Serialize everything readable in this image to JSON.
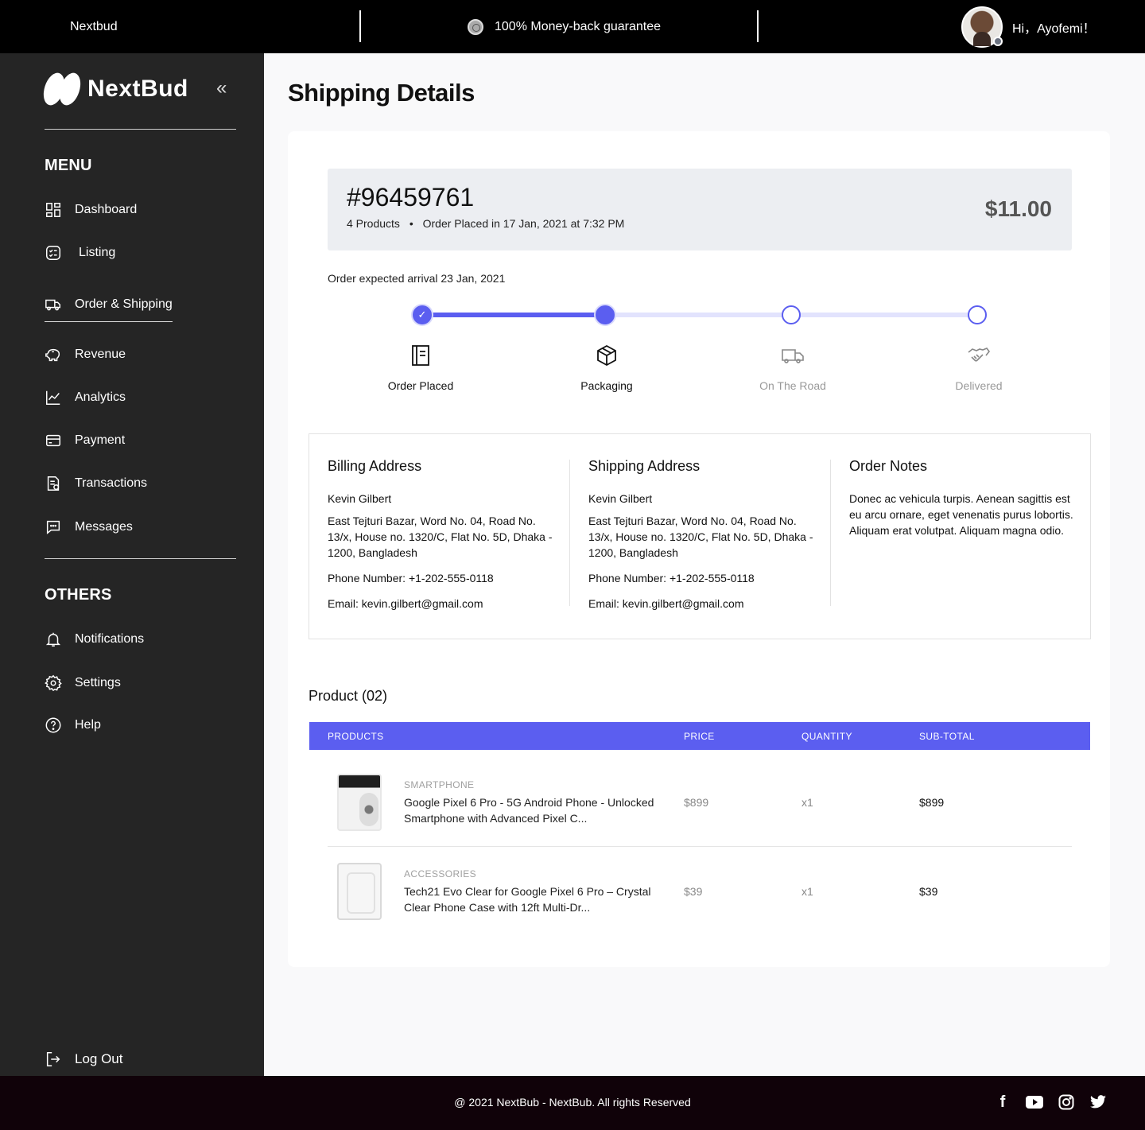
{
  "topbar": {
    "brand": "Nextbud",
    "promo": "100% Money-back guarantee",
    "greeting": "Hi，Ayofemi！"
  },
  "sidebar": {
    "logo": "NextBud",
    "collapse_icon": "double-chevron-left",
    "menu_title": "MENU",
    "menu_items": [
      {
        "label": "Dashboard",
        "icon": "dashboard-icon"
      },
      {
        "label": "Listing",
        "icon": "listing-icon"
      },
      {
        "label": "Order & Shipping",
        "icon": "truck-icon",
        "active": true
      },
      {
        "label": "Revenue",
        "icon": "piggy-bank-icon"
      },
      {
        "label": "Analytics",
        "icon": "chart-icon"
      },
      {
        "label": "Payment",
        "icon": "card-icon"
      },
      {
        "label": "Transactions",
        "icon": "receipt-icon"
      },
      {
        "label": "Messages",
        "icon": "chat-icon"
      }
    ],
    "others_title": "OTHERS",
    "other_items": [
      {
        "label": "Notifications",
        "icon": "bell-icon"
      },
      {
        "label": "Settings",
        "icon": "gear-icon"
      },
      {
        "label": "Help",
        "icon": "help-icon"
      }
    ],
    "logout": "Log Out"
  },
  "page": {
    "title": "Shipping Details"
  },
  "order": {
    "id": "#96459761",
    "products_count": "4 Products",
    "placed": "Order Placed in 17 Jan, 2021 at 7:32 PM",
    "total": "$11.00",
    "arrival": "Order expected arrival 23 Jan, 2021",
    "steps": [
      {
        "label": "Order Placed",
        "status": "done"
      },
      {
        "label": "Packaging",
        "status": "current"
      },
      {
        "label": "On The Road",
        "status": "pending"
      },
      {
        "label": "Delivered",
        "status": "pending"
      }
    ],
    "progress": 0.333
  },
  "billing": {
    "title": "Billing Address",
    "name": "Kevin Gilbert",
    "address": "East Tejturi Bazar, Word No. 04, Road No. 13/x, House no. 1320/C, Flat No. 5D, Dhaka - 1200, Bangladesh",
    "phone": "Phone Number: +1-202-555-0118",
    "email": "Email: kevin.gilbert@gmail.com"
  },
  "shipping": {
    "title": "Shipping Address",
    "name": "Kevin Gilbert",
    "address": "East Tejturi Bazar, Word No. 04, Road No. 13/x, House no. 1320/C, Flat No. 5D, Dhaka - 1200, Bangladesh",
    "phone": "Phone Number: +1-202-555-0118",
    "email": "Email: kevin.gilbert@gmail.com"
  },
  "notes": {
    "title": "Order Notes",
    "text": "Donec ac vehicula turpis. Aenean sagittis est eu arcu ornare, eget venenatis purus lobortis. Aliquam erat volutpat. Aliquam magna odio."
  },
  "products": {
    "title": "Product (02)",
    "headers": [
      "PRODUCTS",
      "PRICE",
      "QUANTITY",
      "SUB-TOTAL"
    ],
    "rows": [
      {
        "category": "SMARTPHONE",
        "name": "Google Pixel 6 Pro - 5G Android Phone - Unlocked Smartphone with Advanced Pixel C...",
        "price": "$899",
        "qty": "x1",
        "subtotal": "$899"
      },
      {
        "category": "ACCESSORIES",
        "name": "Tech21 Evo Clear for Google Pixel 6 Pro – Crystal Clear Phone Case with 12ft Multi-Dr...",
        "price": "$39",
        "qty": "x1",
        "subtotal": "$39"
      }
    ]
  },
  "footer": {
    "copyright": "@ 2021 NextBub - NextBub. All rights Reserved",
    "socials": [
      {
        "name": "facebook-icon",
        "glyph": "f"
      },
      {
        "name": "youtube-icon",
        "glyph": "▶"
      },
      {
        "name": "instagram-icon",
        "glyph": "◎"
      },
      {
        "name": "twitter-icon",
        "glyph": "🐦"
      }
    ]
  },
  "colors": {
    "accent": "#5b5ef0",
    "sidebar_bg": "#252525",
    "topbar_bg": "#000000",
    "footer_bg": "#100209"
  }
}
